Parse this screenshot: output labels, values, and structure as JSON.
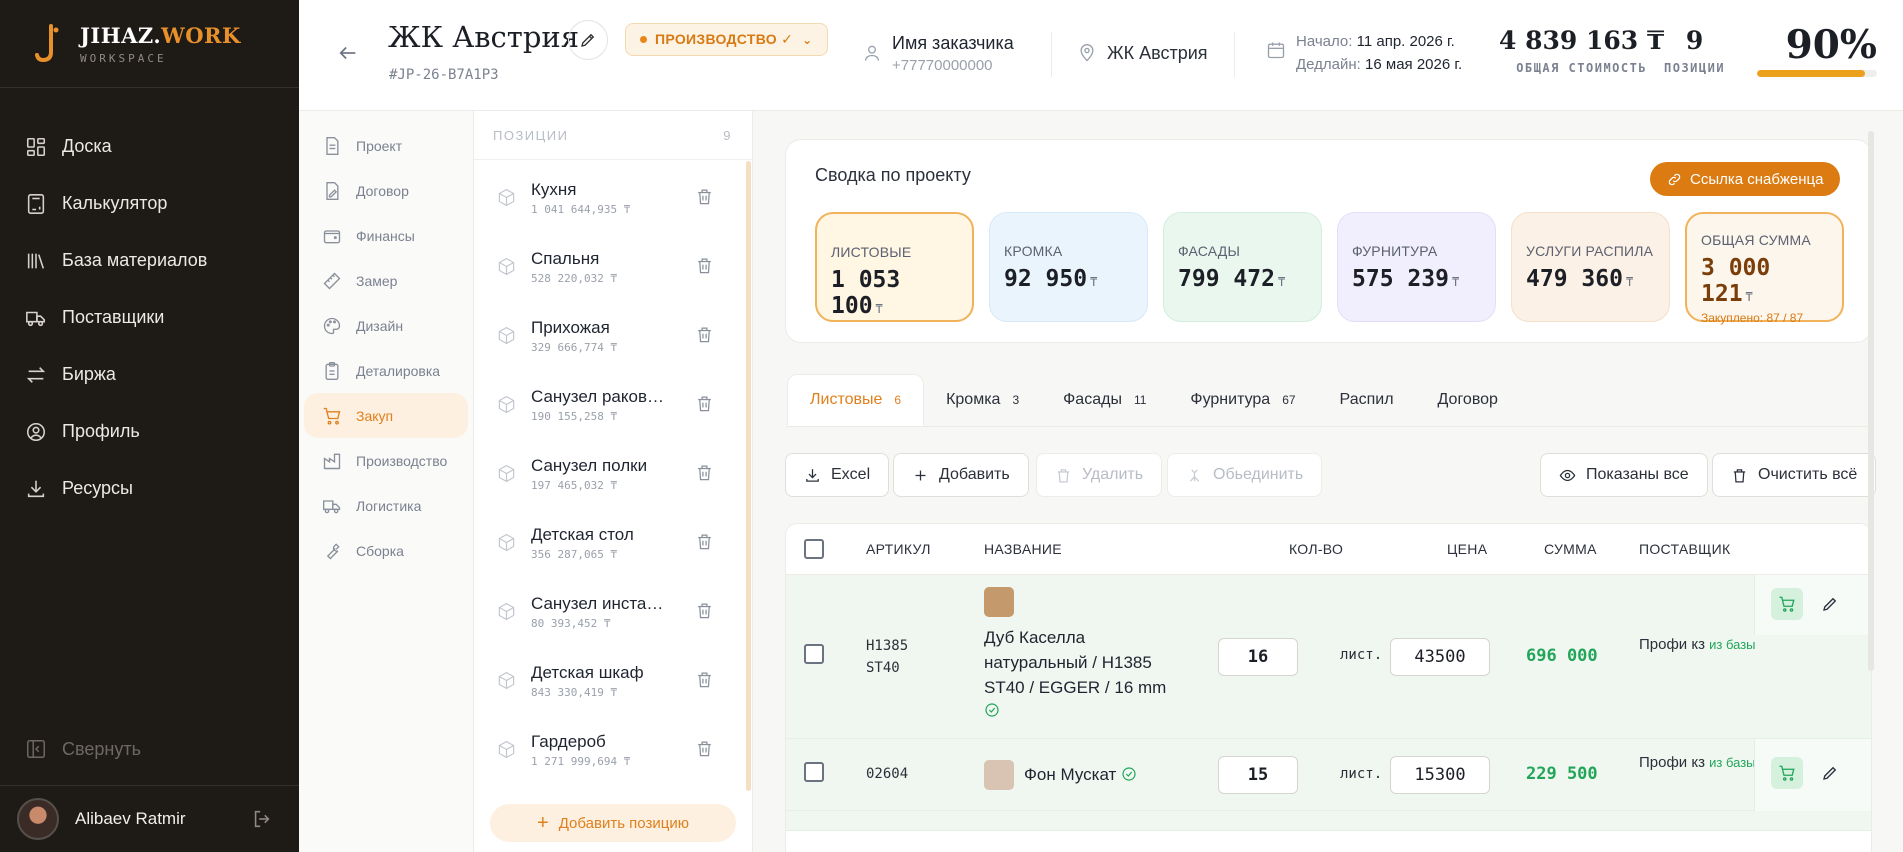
{
  "brand": {
    "name_part1": "JIHAZ.",
    "name_part2": "WORK",
    "sub": "WORKSPACE"
  },
  "sidebar": {
    "items": [
      {
        "label": "Доска",
        "icon": "dashboard-icon"
      },
      {
        "label": "Калькулятор",
        "icon": "calculator-icon"
      },
      {
        "label": "База материалов",
        "icon": "library-icon"
      },
      {
        "label": "Поставщики",
        "icon": "truck-icon"
      },
      {
        "label": "Биржа",
        "icon": "exchange-icon"
      },
      {
        "label": "Профиль",
        "icon": "user-circle-icon"
      },
      {
        "label": "Ресурсы",
        "icon": "download-icon"
      }
    ],
    "collapse_label": "Свернуть",
    "user_name": "Alibaev Ratmir"
  },
  "header": {
    "title": "ЖК Австрия",
    "code": "#JP-26-B7A1P3",
    "status": "ПРОИЗВОДСТВО ✓",
    "customer_name": "Имя заказчика",
    "customer_phone": "+77770000000",
    "location": "ЖК Австрия",
    "start_label": "Начало:",
    "start_value": "11 апр. 2026 г.",
    "deadline_label": "Дедлайн:",
    "deadline_value": "16 мая 2026 г.",
    "total_value": "4 839 163 ₸",
    "total_label": "ОБЩАЯ СТОИМОСТЬ",
    "positions_value": "9",
    "positions_label": "ПОЗИЦИИ",
    "progress_text": "90%",
    "progress_fraction": 0.9,
    "progress_color": "#eca11c"
  },
  "subnav": {
    "items": [
      {
        "label": "Проект",
        "icon": "document-icon",
        "active": false
      },
      {
        "label": "Договор",
        "icon": "contract-icon",
        "active": false
      },
      {
        "label": "Финансы",
        "icon": "wallet-icon",
        "active": false
      },
      {
        "label": "Замер",
        "icon": "ruler-icon",
        "active": false
      },
      {
        "label": "Дизайн",
        "icon": "palette-icon",
        "active": false
      },
      {
        "label": "Деталировка",
        "icon": "clipboard-icon",
        "active": false
      },
      {
        "label": "Закуп",
        "icon": "cart-icon",
        "active": true
      },
      {
        "label": "Производство",
        "icon": "factory-icon",
        "active": false
      },
      {
        "label": "Логистика",
        "icon": "truck-icon",
        "active": false
      },
      {
        "label": "Сборка",
        "icon": "wrench-icon",
        "active": false
      }
    ]
  },
  "positions": {
    "header": "ПОЗИЦИИ",
    "count": "9",
    "items": [
      {
        "name": "Кухня",
        "sum": "1 041 644,935 ₸"
      },
      {
        "name": "Спальня",
        "sum": "528 220,032 ₸"
      },
      {
        "name": "Прихожая",
        "sum": "329 666,774 ₸"
      },
      {
        "name": "Санузел раковина",
        "sum": "190 155,258 ₸"
      },
      {
        "name": "Санузел полки",
        "sum": "197 465,032 ₸"
      },
      {
        "name": "Детская стол",
        "sum": "356 287,065 ₸"
      },
      {
        "name": "Санузел инсталляция",
        "sum": "80 393,452 ₸"
      },
      {
        "name": "Детская шкаф",
        "sum": "843 330,419 ₸"
      },
      {
        "name": "Гардероб",
        "sum": "1 271 999,694 ₸"
      }
    ],
    "add_label": "Добавить позицию"
  },
  "summary": {
    "title": "Сводка по проекту",
    "link_label": "Ссылка снабженца",
    "cards": [
      {
        "label": "ЛИСТОВЫЕ",
        "value": "1 053 100",
        "currency": "₸",
        "bg": "#fff6e3",
        "border": "#f0b25a"
      },
      {
        "label": "КРОМКА",
        "value": "92 950",
        "currency": "₸",
        "bg": "#eaf4fd",
        "border": "#d7e8f8"
      },
      {
        "label": "ФАСАДЫ",
        "value": "799 472",
        "currency": "₸",
        "bg": "#e9f7ef",
        "border": "#d3eede"
      },
      {
        "label": "ФУРНИТУРА",
        "value": "575 239",
        "currency": "₸",
        "bg": "#f1effd",
        "border": "#e2def9"
      },
      {
        "label": "УСЛУГИ РАСПИЛА",
        "value": "479 360",
        "currency": "₸",
        "bg": "#fcf1e6",
        "border": "#f4e0cb"
      },
      {
        "label": "ОБЩАЯ СУММА",
        "value": "3 000 121",
        "currency": "₸",
        "bg": "#fdf6ec",
        "border": "#f0b25a",
        "sub": "Закуплено: 87 / 87"
      }
    ]
  },
  "tabs": [
    {
      "label": "Листовые",
      "count": "6",
      "active": true
    },
    {
      "label": "Кромка",
      "count": "3",
      "active": false
    },
    {
      "label": "Фасады",
      "count": "11",
      "active": false
    },
    {
      "label": "Фурнитура",
      "count": "67",
      "active": false
    },
    {
      "label": "Распил",
      "count": "",
      "active": false
    },
    {
      "label": "Договор",
      "count": "",
      "active": false
    }
  ],
  "toolbar": {
    "excel": "Excel",
    "add": "Добавить",
    "delete": "Удалить",
    "merge": "Обьединить",
    "show_all": "Показаны все",
    "clear_all": "Очистить всё"
  },
  "table": {
    "headers": {
      "article": "АРТИКУЛ",
      "name": "НАЗВАНИЕ",
      "qty": "КОЛ-ВО",
      "price": "ЦЕНА",
      "sum": "СУММА",
      "supplier": "ПОСТАВЩИК"
    },
    "rows": [
      {
        "article_line1": "H1385",
        "article_line2": "ST40",
        "name": "Дуб Каселла натуральный / H1385 ST40 / EGGER / 16 mm",
        "swatch": "#c49a6c",
        "qty": "16",
        "unit": "лист.",
        "price": "43500",
        "sum": "696 000",
        "supplier": "Профи кз",
        "source": "из базы"
      },
      {
        "article_line1": "02604",
        "article_line2": "",
        "name": "Фон Мускат",
        "swatch": "#d9c3b3",
        "qty": "15",
        "unit": "лист.",
        "price": "15300",
        "sum": "229 500",
        "supplier": "Профи кз",
        "source": "из базы"
      }
    ]
  }
}
